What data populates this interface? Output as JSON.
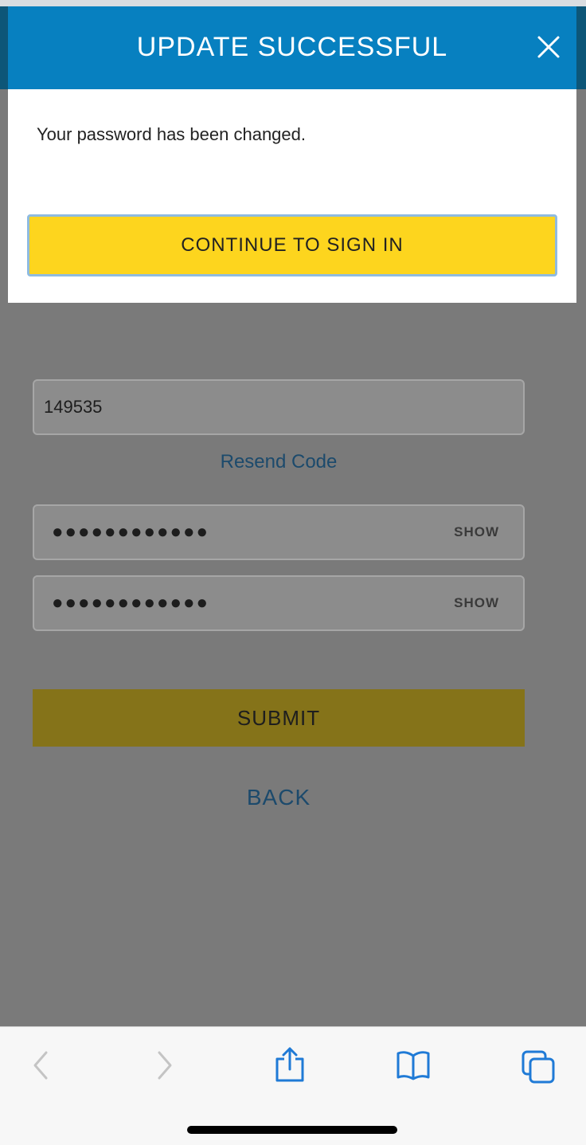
{
  "modal": {
    "title": "UPDATE SUCCESSFUL",
    "message": "Your password has been changed.",
    "continue_label": "CONTINUE TO SIGN IN"
  },
  "form": {
    "code_value": "149535",
    "resend_label": "Resend Code",
    "password_mask": "●●●●●●●●●●●●",
    "confirm_mask": "●●●●●●●●●●●●",
    "show_label": "SHOW",
    "submit_label": "SUBMIT",
    "back_label": "BACK"
  },
  "toolbar": {
    "icons": [
      "back-arrow-icon",
      "forward-arrow-icon",
      "share-icon",
      "bookmarks-icon",
      "tabs-icon"
    ]
  },
  "colors": {
    "header_blue": "#0780c0",
    "accent_yellow": "#fdd51e",
    "ios_blue": "#1f7ad6"
  }
}
